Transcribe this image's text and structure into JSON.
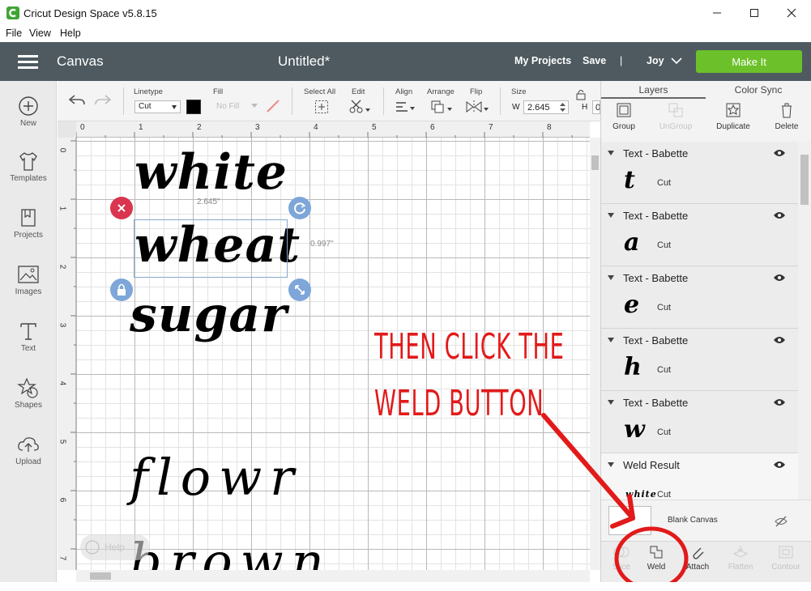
{
  "window": {
    "title": "Cricut Design Space  v5.8.15"
  },
  "menu": [
    "File",
    "View",
    "Help"
  ],
  "header": {
    "section": "Canvas",
    "doc_title": "Untitled*",
    "my_projects": "My Projects",
    "save": "Save",
    "divider": "|",
    "user": "Joy",
    "make_it": "Make It",
    "accent": "#6cc12a"
  },
  "sidebar": [
    {
      "label": "New",
      "icon": "plus-circle-icon"
    },
    {
      "label": "Templates",
      "icon": "tshirt-icon"
    },
    {
      "label": "Projects",
      "icon": "projects-icon"
    },
    {
      "label": "Images",
      "icon": "image-icon"
    },
    {
      "label": "Text",
      "icon": "text-icon"
    },
    {
      "label": "Shapes",
      "icon": "shapes-icon"
    },
    {
      "label": "Upload",
      "icon": "upload-icon"
    }
  ],
  "toolbar": {
    "linetype_label": "Linetype",
    "linetype_value": "Cut",
    "fill_label": "Fill",
    "fill_value": "No Fill",
    "select_all": "Select All",
    "edit": "Edit",
    "align": "Align",
    "arrange": "Arrange",
    "flip": "Flip",
    "size": "Size",
    "w_label": "W",
    "w_value": "2.645",
    "h_label": "H",
    "h_value": "0"
  },
  "ruler": {
    "top": [
      "0",
      "1",
      "2",
      "3",
      "4",
      "5",
      "6",
      "7",
      "8"
    ],
    "left": [
      "0",
      "1",
      "2",
      "3",
      "4",
      "5",
      "6",
      "7"
    ]
  },
  "canvas": {
    "words": [
      "white",
      "wheat",
      "sugar",
      "flowr",
      "brown"
    ],
    "width_readout": "2.645\"",
    "height_readout": "0.997\"",
    "help_text": "Help",
    "annotation_line1": "THEN CLICK THE",
    "annotation_line2": "WELD BUTTON",
    "annotation_color": "#e21a1a"
  },
  "right_panel": {
    "tabs": [
      "Layers",
      "Color Sync"
    ],
    "actions": [
      "Group",
      "UnGroup",
      "Duplicate",
      "Delete"
    ],
    "layers": [
      {
        "name": "Text - Babette",
        "glyph": "t",
        "op": "Cut"
      },
      {
        "name": "Text - Babette",
        "glyph": "a",
        "op": "Cut"
      },
      {
        "name": "Text - Babette",
        "glyph": "e",
        "op": "Cut"
      },
      {
        "name": "Text - Babette",
        "glyph": "h",
        "op": "Cut"
      },
      {
        "name": "Text - Babette",
        "glyph": "w",
        "op": "Cut"
      },
      {
        "name": "Weld Result",
        "glyph": "white",
        "op": "Cut"
      }
    ],
    "blank_canvas": "Blank Canvas",
    "bottom_actions": [
      "Slice",
      "Weld",
      "Attach",
      "Flatten",
      "Contour"
    ]
  }
}
